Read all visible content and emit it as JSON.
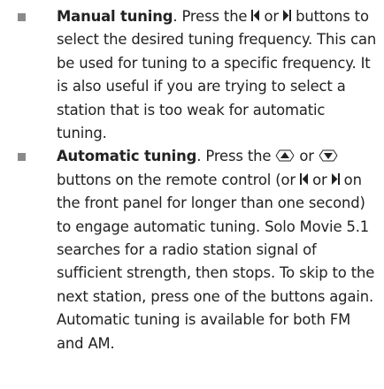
{
  "items": [
    {
      "title": "Manual tuning",
      "t1": ". Press the ",
      "t2": " or ",
      "t3": " buttons to select the desired tuning frequency. This can be used for tuning to a specific frequency. It is also useful if you are trying to select a station that is too weak for automatic tuning."
    },
    {
      "title": "Automatic tuning",
      "t1": ". Press the ",
      "t2": " or ",
      "t3": " buttons on the remote control (or ",
      "t4": " or ",
      "t5": " on the front panel for longer than one second) to engage automatic tuning. Solo Movie 5.1 searches for a radio station signal of sufficient strength, then stops. To skip to the next station, press one of the buttons again. Automatic tuning is available for both FM and AM."
    }
  ],
  "icons": {
    "previous": "skip-previous-icon",
    "next": "skip-next-icon",
    "up": "tune-up-icon",
    "down": "tune-down-icon"
  },
  "colors": {
    "text": "#222222",
    "bullet": "#8a8a8a"
  }
}
